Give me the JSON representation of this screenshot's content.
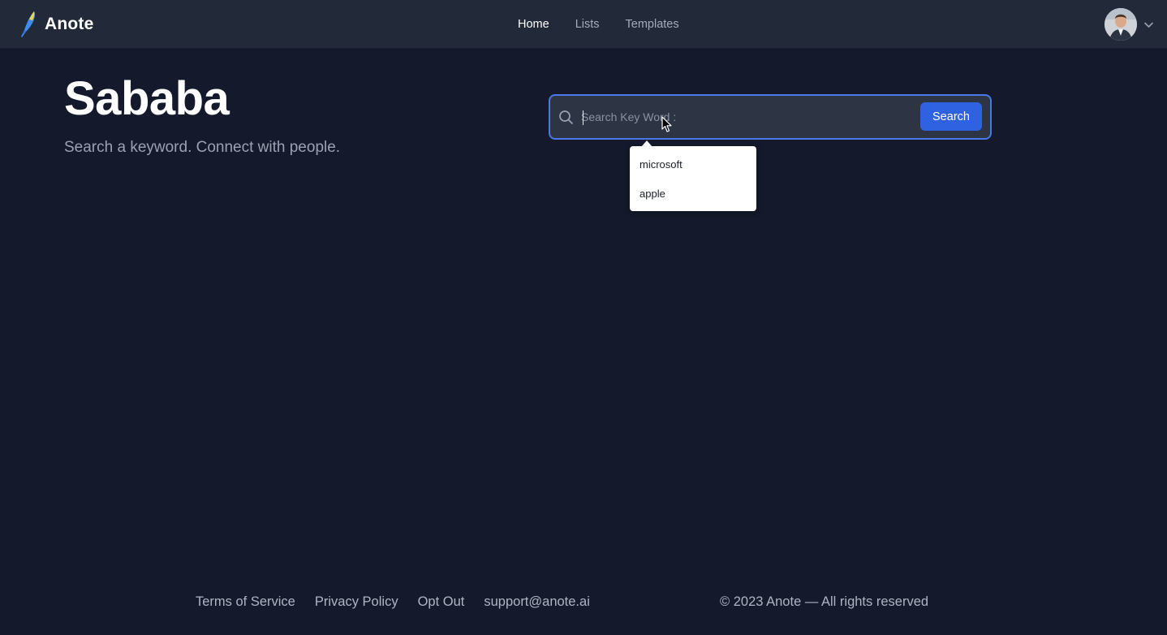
{
  "app": {
    "name": "Anote"
  },
  "nav": {
    "items": [
      {
        "label": "Home",
        "active": true
      },
      {
        "label": "Lists",
        "active": false
      },
      {
        "label": "Templates",
        "active": false
      }
    ]
  },
  "account": {
    "avatar_icon": "user-avatar",
    "menu_icon": "chevron-down-icon"
  },
  "hero": {
    "title": "Sababa",
    "subtitle": "Search a keyword. Connect with people."
  },
  "search": {
    "placeholder": "Search Key Word :",
    "value": "",
    "button_label": "Search",
    "icon": "search-icon",
    "suggestions": [
      "microsoft",
      "apple"
    ]
  },
  "footer": {
    "links": [
      "Terms of Service",
      "Privacy Policy",
      "Opt Out",
      "support@anote.ai"
    ],
    "copyright": "© 2023 Anote — All rights reserved"
  },
  "colors": {
    "background": "#141a2b",
    "topbar": "#222939",
    "accent": "#2f62e0",
    "search_border": "#4a78e6"
  }
}
